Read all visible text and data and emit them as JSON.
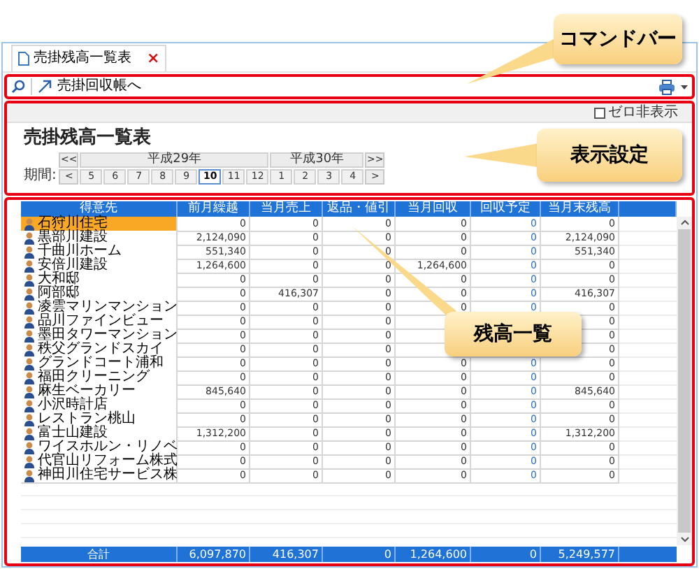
{
  "tab": {
    "label": "売掛残高一覧表",
    "close": "×"
  },
  "command_bar": {
    "actions": [
      {
        "label": "売掛回収帳へ"
      }
    ]
  },
  "zero_hide": {
    "label": "ゼロ非表示",
    "checked": false
  },
  "settings": {
    "title": "売掛残高一覧表",
    "period_label": "期間:",
    "first": "<<",
    "prev": "<",
    "next": ">",
    "last": ">>",
    "years": [
      {
        "label": "平成29年",
        "months": [
          {
            "label": "5",
            "selected": false
          },
          {
            "label": "6",
            "selected": false
          },
          {
            "label": "7",
            "selected": false
          },
          {
            "label": "8",
            "selected": false
          },
          {
            "label": "9",
            "selected": false
          },
          {
            "label": "10",
            "selected": true
          },
          {
            "label": "11",
            "selected": false
          },
          {
            "label": "12",
            "selected": false
          }
        ]
      },
      {
        "label": "平成30年",
        "months": [
          {
            "label": "1",
            "selected": false
          },
          {
            "label": "2",
            "selected": false
          },
          {
            "label": "3",
            "selected": false
          },
          {
            "label": "4",
            "selected": false
          }
        ]
      }
    ]
  },
  "table": {
    "columns": [
      {
        "label": "得意先",
        "kind": "name"
      },
      {
        "label": "前月繰越",
        "kind": "amount"
      },
      {
        "label": "当月売上",
        "kind": "amount"
      },
      {
        "label": "返品・値引",
        "kind": "amount"
      },
      {
        "label": "当月回収",
        "kind": "amount"
      },
      {
        "label": "回収予定",
        "kind": "planned"
      },
      {
        "label": "当月末残高",
        "kind": "amount"
      }
    ],
    "rows": [
      {
        "selected": true,
        "cells": [
          "石狩川住宅",
          "0",
          "0",
          "0",
          "0",
          "0",
          "0"
        ]
      },
      {
        "selected": false,
        "cells": [
          "黒部川建設",
          "2,124,090",
          "0",
          "0",
          "0",
          "0",
          "2,124,090"
        ]
      },
      {
        "selected": false,
        "cells": [
          "千曲川ホーム",
          "551,340",
          "0",
          "0",
          "0",
          "0",
          "551,340"
        ]
      },
      {
        "selected": false,
        "cells": [
          "安倍川建設",
          "1,264,600",
          "0",
          "0",
          "1,264,600",
          "0",
          "0"
        ]
      },
      {
        "selected": false,
        "cells": [
          "大和邸",
          "0",
          "0",
          "0",
          "0",
          "0",
          "0"
        ]
      },
      {
        "selected": false,
        "cells": [
          "阿部邸",
          "0",
          "416,307",
          "0",
          "0",
          "0",
          "416,307"
        ]
      },
      {
        "selected": false,
        "cells": [
          "凌雲マリンマンション",
          "0",
          "0",
          "0",
          "0",
          "0",
          "0"
        ]
      },
      {
        "selected": false,
        "cells": [
          "品川ファインビュー",
          "0",
          "0",
          "0",
          null,
          null,
          "0"
        ]
      },
      {
        "selected": false,
        "cells": [
          "墨田タワーマンション",
          "0",
          "0",
          "0",
          null,
          null,
          "0"
        ]
      },
      {
        "selected": false,
        "cells": [
          "秩父グランドスカイ",
          "0",
          "0",
          "0",
          null,
          null,
          "0"
        ]
      },
      {
        "selected": false,
        "cells": [
          "グランドコート浦和",
          "0",
          "0",
          "0",
          "0",
          "0",
          "0"
        ]
      },
      {
        "selected": false,
        "cells": [
          "福田クリーニング",
          "0",
          "0",
          "0",
          "0",
          "0",
          "0"
        ]
      },
      {
        "selected": false,
        "cells": [
          "麻生ベーカリー",
          "845,640",
          "0",
          "0",
          "0",
          "0",
          "845,640"
        ]
      },
      {
        "selected": false,
        "cells": [
          "小沢時計店",
          "0",
          "0",
          "0",
          "0",
          "0",
          "0"
        ]
      },
      {
        "selected": false,
        "cells": [
          "レストラン桃山",
          "0",
          "0",
          "0",
          "0",
          "0",
          "0"
        ]
      },
      {
        "selected": false,
        "cells": [
          "富士山建設",
          "1,312,200",
          "0",
          "0",
          "0",
          "0",
          "1,312,200"
        ]
      },
      {
        "selected": false,
        "cells": [
          "ワイスホルン・リノベ",
          "0",
          "0",
          "0",
          "0",
          "0",
          "0"
        ]
      },
      {
        "selected": false,
        "cells": [
          "代官山リフォーム株式",
          "0",
          "0",
          "0",
          "0",
          "0",
          "0"
        ]
      },
      {
        "selected": false,
        "cells": [
          "神田川住宅サービス株",
          "0",
          "0",
          "0",
          "0",
          "0",
          "0"
        ]
      }
    ],
    "total": [
      "合計",
      "6,097,870",
      "416,307",
      "0",
      "1,264,600",
      "0",
      "5,249,577"
    ]
  },
  "annotations": [
    {
      "label": "コマンドバー"
    },
    {
      "label": "表示設定"
    },
    {
      "label": "残高一覧"
    }
  ]
}
